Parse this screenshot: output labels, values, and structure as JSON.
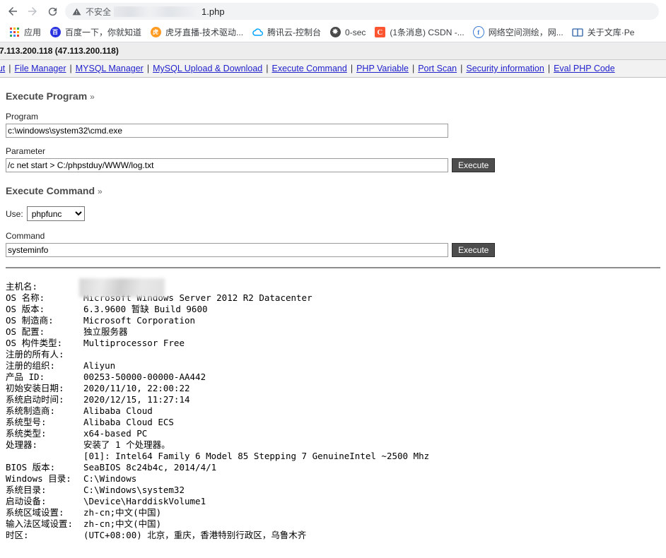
{
  "browser": {
    "back_label": "back-arrow",
    "forward_label": "forward-arrow",
    "reload_label": "reload",
    "security_text": "不安全",
    "url_visible": "1.php",
    "bookmarks": [
      {
        "label": "应用",
        "icon": "apps-grid-icon",
        "color": "#4285f4",
        "glyph": ""
      },
      {
        "label": "百度一下，你就知道",
        "icon": "baidu-icon",
        "color": "#2932e1",
        "glyph": "百"
      },
      {
        "label": "虎牙直播-技术驱动...",
        "icon": "huya-icon",
        "color": "#f90",
        "glyph": "虎"
      },
      {
        "label": "腾讯云-控制台",
        "icon": "tencent-cloud-icon",
        "color": "#00a4ff",
        "glyph": "云"
      },
      {
        "label": "0-sec",
        "icon": "globe-icon",
        "color": "#4a4a4a",
        "glyph": "⊕"
      },
      {
        "label": "(1条消息) CSDN -...",
        "icon": "csdn-icon",
        "color": "#fc5531",
        "glyph": "C"
      },
      {
        "label": "网络空间测绘，网...",
        "icon": "fofa-icon",
        "color": "#3a7bd5",
        "glyph": "F"
      },
      {
        "label": "关于文库·Pe",
        "icon": "book-icon",
        "color": "#2f63a8",
        "glyph": "▥"
      }
    ]
  },
  "shell": {
    "header": "7.113.200.118 (47.113.200.118)",
    "nav_links": [
      "ogout",
      "File Manager",
      "MYSQL Manager",
      "MySQL Upload & Download",
      "Execute Command",
      "PHP Variable",
      "Port Scan",
      "Security information",
      "Eval PHP Code"
    ],
    "execute_program": {
      "title": "Execute Program",
      "chevron": "»",
      "program_label": "Program",
      "program_value": "c:\\windows\\system32\\cmd.exe",
      "parameter_label": "Parameter",
      "parameter_value": "/c net start > C:/phpstduy/WWW/log.txt",
      "execute_label": "Execute"
    },
    "execute_command": {
      "title": "Execute Command",
      "chevron": "»",
      "use_label": "Use:",
      "use_value": "phpfunc",
      "use_options": [
        "phpfunc"
      ],
      "command_label": "Command",
      "command_value": "systeminfo",
      "execute_label": "Execute"
    }
  },
  "systeminfo": {
    "host_redacted": true,
    "rows": [
      {
        "key": "主机名:",
        "value": ""
      },
      {
        "key": "OS 名称:",
        "value": "Microsoft Windows Server 2012 R2 Datacenter"
      },
      {
        "key": "OS 版本:",
        "value": "6.3.9600 暂缺 Build 9600"
      },
      {
        "key": "OS 制造商:",
        "value": "Microsoft Corporation"
      },
      {
        "key": "OS 配置:",
        "value": "独立服务器"
      },
      {
        "key": "OS 构件类型:",
        "value": "Multiprocessor Free"
      },
      {
        "key": "注册的所有人:",
        "value": ""
      },
      {
        "key": "注册的组织:",
        "value": "Aliyun"
      },
      {
        "key": "产品 ID:",
        "value": "00253-50000-00000-AA442"
      },
      {
        "key": "初始安装日期:",
        "value": "2020/11/10, 22:00:22"
      },
      {
        "key": "系统启动时间:",
        "value": "2020/12/15, 11:27:14"
      },
      {
        "key": "系统制造商:",
        "value": "Alibaba Cloud"
      },
      {
        "key": "系统型号:",
        "value": "Alibaba Cloud ECS"
      },
      {
        "key": "系统类型:",
        "value": "x64-based PC"
      },
      {
        "key": "处理器:",
        "value": "安装了 1 个处理器。",
        "continuation": "[01]: Intel64 Family 6 Model 85 Stepping 7 GenuineIntel ~2500 Mhz"
      },
      {
        "key": "BIOS 版本:",
        "value": "SeaBIOS 8c24b4c, 2014/4/1"
      },
      {
        "key": "Windows 目录:",
        "value": "C:\\Windows"
      },
      {
        "key": "系统目录:",
        "value": "C:\\Windows\\system32"
      },
      {
        "key": "启动设备:",
        "value": "\\Device\\HarddiskVolume1"
      },
      {
        "key": "系统区域设置:",
        "value": "zh-cn;中文(中国)"
      },
      {
        "key": "输入法区域设置:",
        "value": "zh-cn;中文(中国)"
      },
      {
        "key": "时区:",
        "value": "(UTC+08:00) 北京，重庆，香港特别行政区，乌鲁木齐"
      }
    ]
  }
}
